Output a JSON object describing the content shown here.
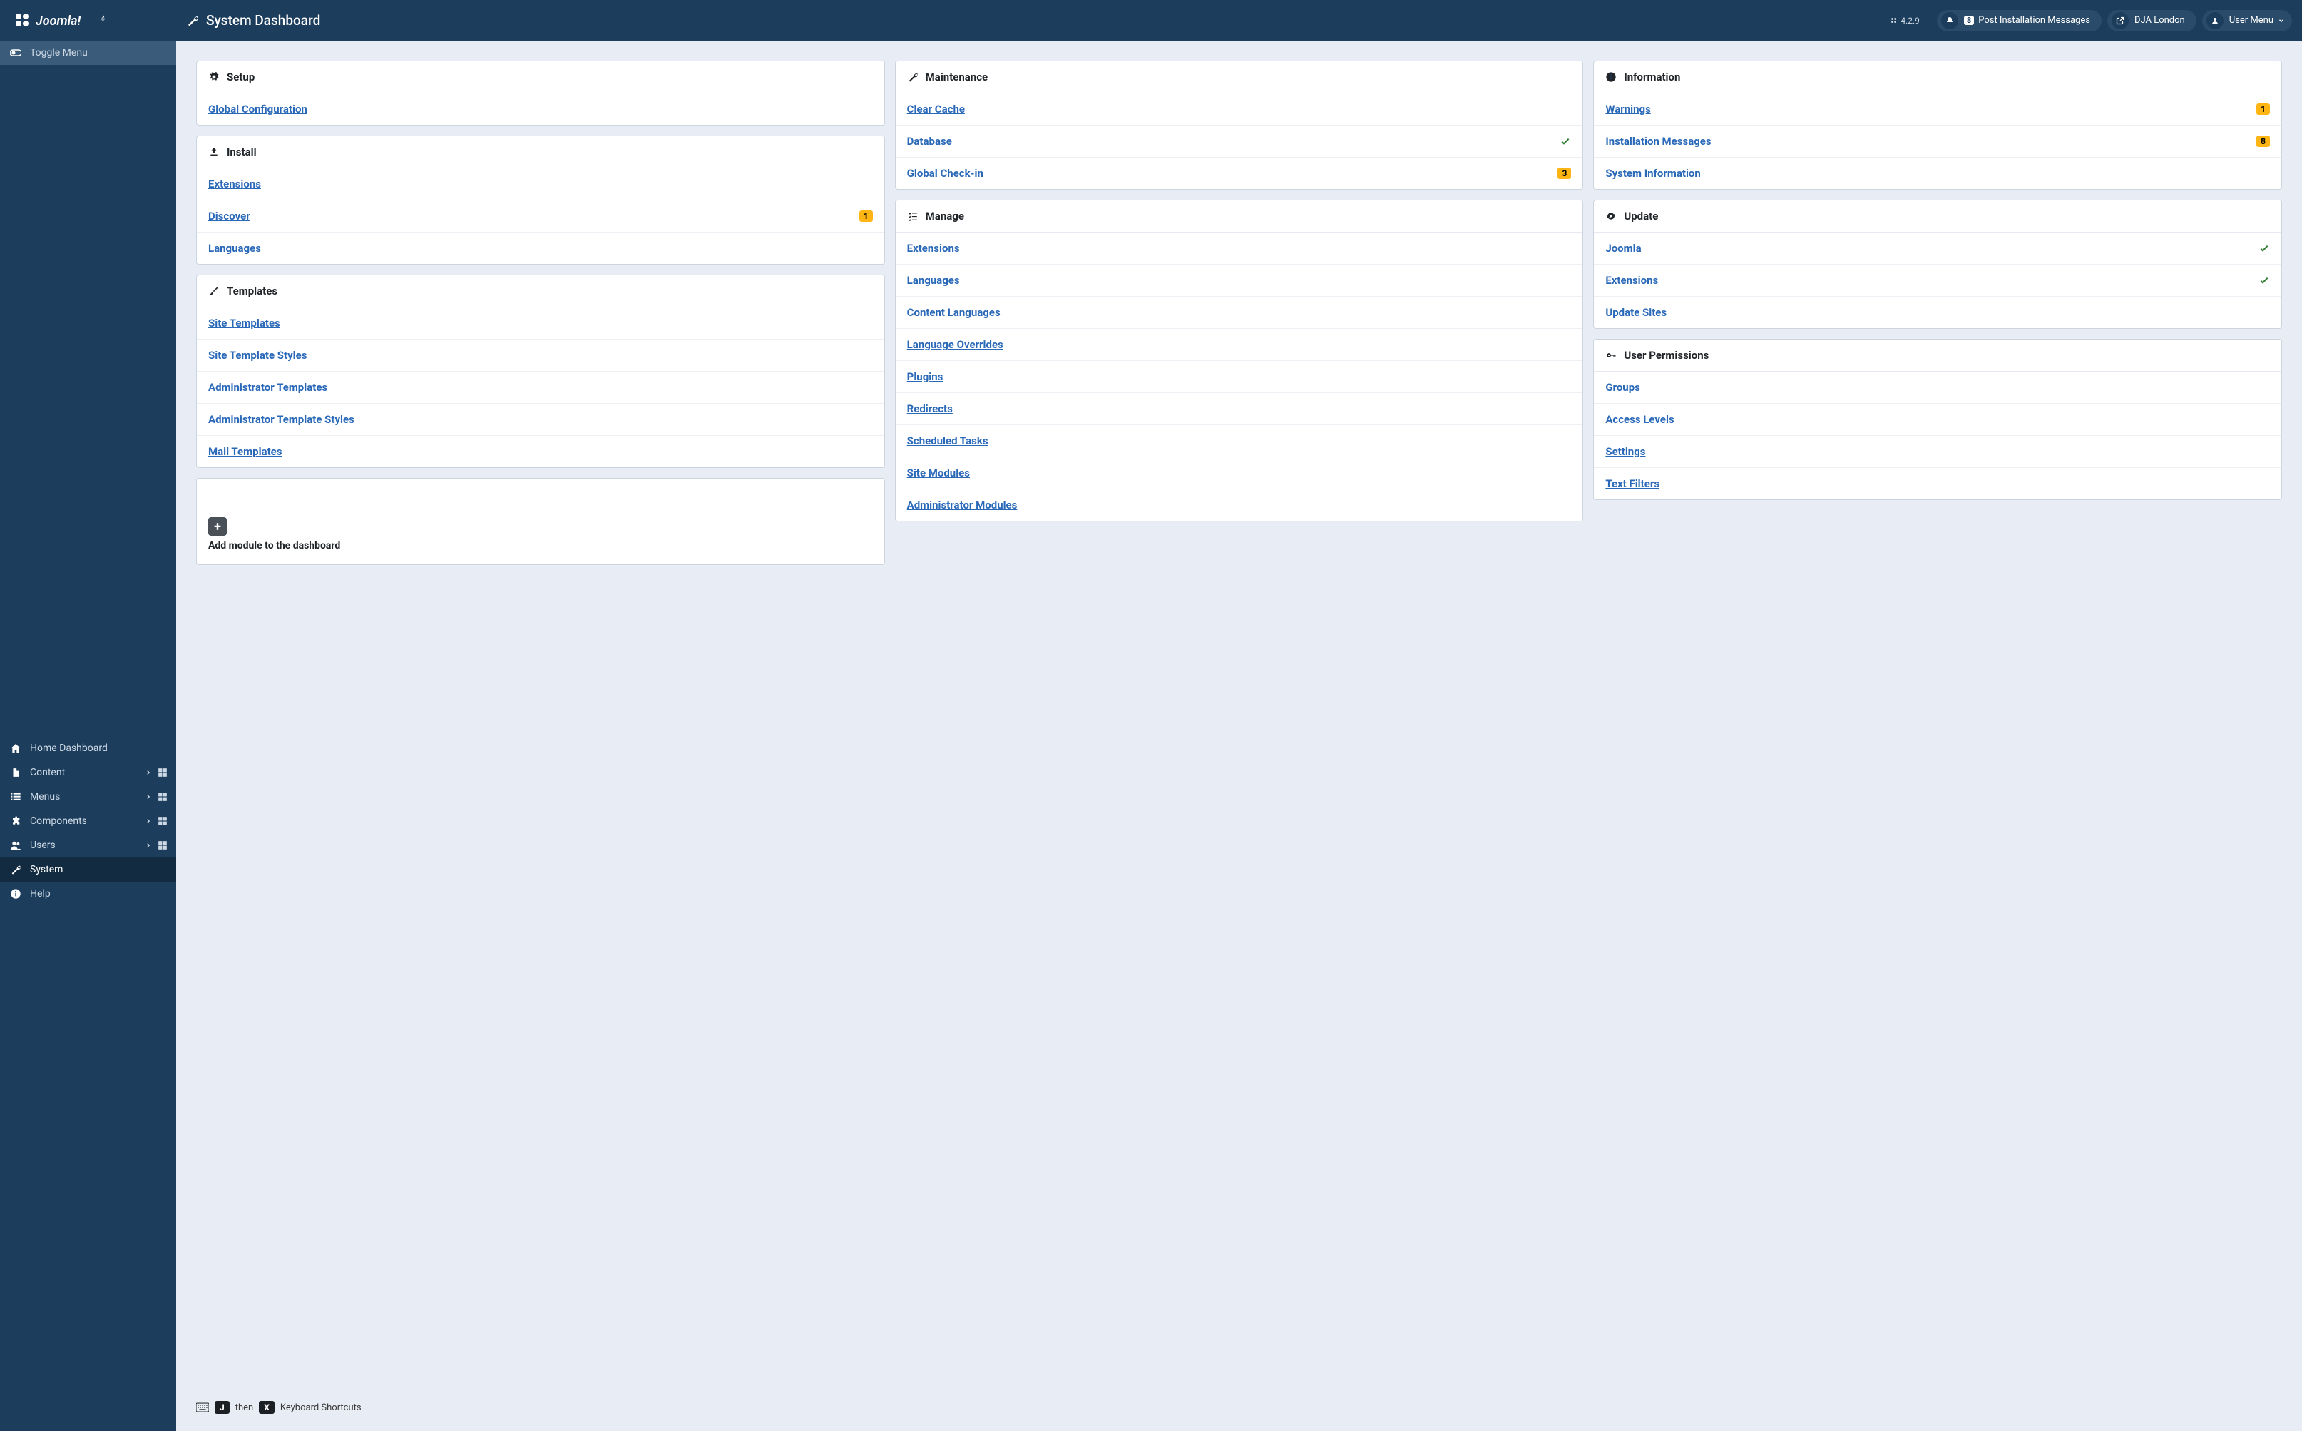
{
  "brand": "Joomla!",
  "header": {
    "page_title": "System Dashboard",
    "version": "4.2.9",
    "notify_count": "8",
    "notify_label": "Post Installation Messages",
    "site_link_label": "DJA London",
    "user_menu_label": "User Menu"
  },
  "sidebar": {
    "toggle": "Toggle Menu",
    "items": [
      {
        "label": "Home Dashboard",
        "icon": "home",
        "expandable": false,
        "grid": false
      },
      {
        "label": "Content",
        "icon": "file",
        "expandable": true,
        "grid": true
      },
      {
        "label": "Menus",
        "icon": "list",
        "expandable": true,
        "grid": true
      },
      {
        "label": "Components",
        "icon": "puzzle",
        "expandable": true,
        "grid": true
      },
      {
        "label": "Users",
        "icon": "users",
        "expandable": true,
        "grid": true
      },
      {
        "label": "System",
        "icon": "wrench",
        "expandable": false,
        "grid": false,
        "active": true
      },
      {
        "label": "Help",
        "icon": "info",
        "expandable": false,
        "grid": false
      }
    ]
  },
  "columns": [
    [
      {
        "title": "Setup",
        "icon": "cog",
        "items": [
          {
            "label": "Global Configuration"
          }
        ]
      },
      {
        "title": "Install",
        "icon": "upload",
        "items": [
          {
            "label": "Extensions"
          },
          {
            "label": "Discover",
            "badge": "1"
          },
          {
            "label": "Languages"
          }
        ]
      },
      {
        "title": "Templates",
        "icon": "brush",
        "items": [
          {
            "label": "Site Templates"
          },
          {
            "label": "Site Template Styles"
          },
          {
            "label": "Administrator Templates"
          },
          {
            "label": "Administrator Template Styles"
          },
          {
            "label": "Mail Templates"
          }
        ]
      }
    ],
    [
      {
        "title": "Maintenance",
        "icon": "wrench",
        "items": [
          {
            "label": "Clear Cache"
          },
          {
            "label": "Database",
            "check": true
          },
          {
            "label": "Global Check-in",
            "badge": "3"
          }
        ]
      },
      {
        "title": "Manage",
        "icon": "list-check",
        "items": [
          {
            "label": "Extensions"
          },
          {
            "label": "Languages"
          },
          {
            "label": "Content Languages"
          },
          {
            "label": "Language Overrides"
          },
          {
            "label": "Plugins"
          },
          {
            "label": "Redirects"
          },
          {
            "label": "Scheduled Tasks"
          },
          {
            "label": "Site Modules"
          },
          {
            "label": "Administrator Modules"
          }
        ]
      }
    ],
    [
      {
        "title": "Information",
        "icon": "info",
        "items": [
          {
            "label": "Warnings",
            "badge": "1"
          },
          {
            "label": "Installation Messages",
            "badge": "8"
          },
          {
            "label": "System Information"
          }
        ]
      },
      {
        "title": "Update",
        "icon": "sync",
        "items": [
          {
            "label": "Joomla",
            "check": true
          },
          {
            "label": "Extensions",
            "check": true
          },
          {
            "label": "Update Sites"
          }
        ]
      },
      {
        "title": "User Permissions",
        "icon": "key",
        "items": [
          {
            "label": "Groups"
          },
          {
            "label": "Access Levels"
          },
          {
            "label": "Settings"
          },
          {
            "label": "Text Filters"
          }
        ]
      }
    ]
  ],
  "add_module": {
    "label": "Add module to the dashboard"
  },
  "footer": {
    "then": "then",
    "key1": "J",
    "key2": "X",
    "shortcuts": "Keyboard Shortcuts"
  }
}
